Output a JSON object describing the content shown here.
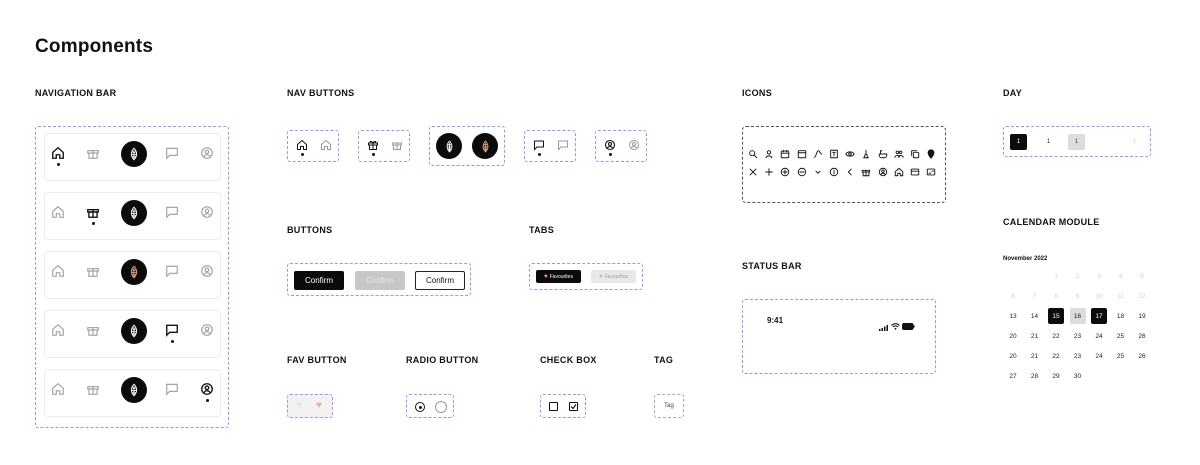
{
  "page_title": "Components",
  "sections": {
    "navigation_bar": "NAVIGATION BAR",
    "nav_buttons": "NAV BUTTONS",
    "icons": "ICONS",
    "day": "DAY",
    "buttons": "BUTTONS",
    "tabs": "TABS",
    "calendar_module": "CALENDAR MODULE",
    "status_bar": "STATUS BAR",
    "fav_button": "FAV BUTTON",
    "radio_button": "RADIO BUTTON",
    "check_box": "CHECK BOX",
    "tag": "TAG"
  },
  "navigation_bar": {
    "rows": [
      {
        "active": "home"
      },
      {
        "active": "gift"
      },
      {
        "active": "fab"
      },
      {
        "active": "chat"
      },
      {
        "active": "profile"
      }
    ]
  },
  "buttons": {
    "primary": "Confirm",
    "disabled": "Confirm",
    "secondary": "Confirm"
  },
  "tabs": {
    "active": "Favourites",
    "inactive": "Favourites"
  },
  "status_bar": {
    "time": "9:41"
  },
  "day": {
    "items": [
      "1",
      "1",
      "1",
      "1"
    ]
  },
  "calendar": {
    "month": "November 2022",
    "rows": [
      [
        "",
        "",
        "1",
        "2",
        "3",
        "4",
        "5"
      ],
      [
        "6",
        "7",
        "8",
        "9",
        "10",
        "11",
        "12"
      ],
      [
        "13",
        "14",
        "15",
        "16",
        "17",
        "18",
        "19"
      ],
      [
        "20",
        "21",
        "22",
        "23",
        "24",
        "25",
        "26"
      ],
      [
        "20",
        "21",
        "22",
        "23",
        "24",
        "25",
        "26"
      ],
      [
        "27",
        "28",
        "29",
        "30",
        "",
        "",
        ""
      ]
    ],
    "selected": [
      "15",
      "17"
    ],
    "range": [
      "16"
    ]
  },
  "tag": {
    "label": "Tag"
  },
  "colors": {
    "accent_border": "#a98ef0",
    "primary": "#0b0b0b",
    "fav_heart": "#f2a7a7"
  }
}
